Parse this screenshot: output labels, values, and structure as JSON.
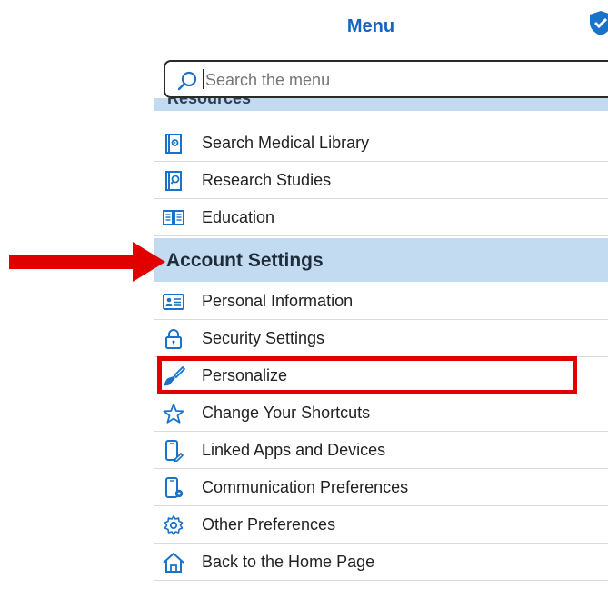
{
  "header": {
    "title": "Menu",
    "shield_icon": "shield-check-icon"
  },
  "search": {
    "placeholder": "Search the menu",
    "value": ""
  },
  "sections": {
    "resources": {
      "label": "Resources"
    },
    "account_settings": {
      "label": "Account Settings"
    }
  },
  "resources_items": [
    {
      "label": "Search Medical Library",
      "icon": "library-book-icon"
    },
    {
      "label": "Research Studies",
      "icon": "research-book-icon"
    },
    {
      "label": "Education",
      "icon": "open-book-icon"
    }
  ],
  "account_items": [
    {
      "label": "Personal Information",
      "icon": "id-card-icon"
    },
    {
      "label": "Security Settings",
      "icon": "lock-icon"
    },
    {
      "label": "Personalize",
      "icon": "paintbrush-icon"
    },
    {
      "label": "Change Your Shortcuts",
      "icon": "star-icon"
    },
    {
      "label": "Linked Apps and Devices",
      "icon": "phone-link-icon"
    },
    {
      "label": "Communication Preferences",
      "icon": "phone-gear-icon"
    },
    {
      "label": "Other Preferences",
      "icon": "gear-icon"
    },
    {
      "label": "Back to the Home Page",
      "icon": "home-icon"
    }
  ],
  "annotations": {
    "arrow_color": "#e00000",
    "highlight_color": "#e00000"
  },
  "colors": {
    "section_bg": "#c3dbf1",
    "title": "#1565c0",
    "icon_blue": "#1a73c8"
  }
}
